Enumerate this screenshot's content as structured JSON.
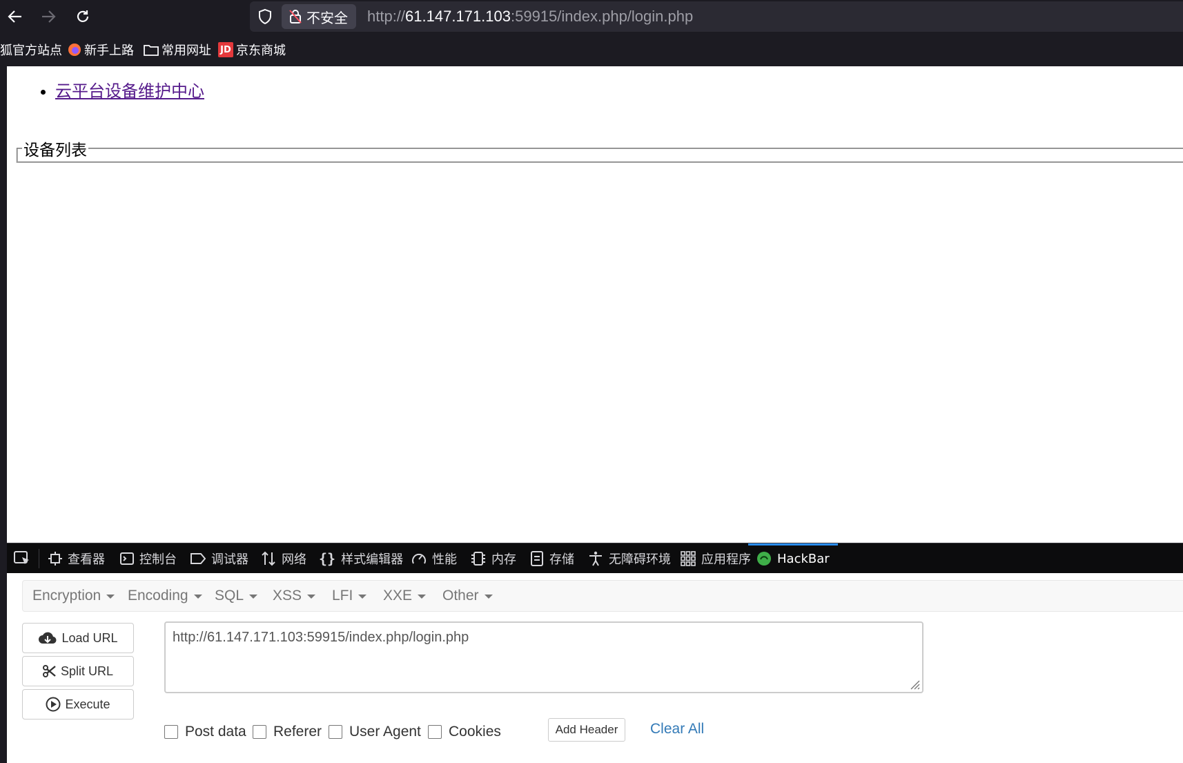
{
  "browser": {
    "security_label": "不安全",
    "url_scheme": "http://",
    "url_host": "61.147.171.103",
    "url_rest": ":59915/index.php/login.php"
  },
  "bookmarks": [
    {
      "label": "狐官方站点",
      "icon": "none"
    },
    {
      "label": "新手上路",
      "icon": "firefox-icon"
    },
    {
      "label": "常用网址",
      "icon": "folder-icon"
    },
    {
      "label": "京东商城",
      "icon": "jd-icon"
    }
  ],
  "jd_icon_text": "JD",
  "page": {
    "link_label": "云平台设备维护中心",
    "fieldset_legend": "设备列表"
  },
  "devtools": {
    "tabs": [
      {
        "label": "查看器",
        "icon": "inspector-icon"
      },
      {
        "label": "控制台",
        "icon": "console-icon"
      },
      {
        "label": "调试器",
        "icon": "debugger-icon"
      },
      {
        "label": "网络",
        "icon": "network-icon"
      },
      {
        "label": "样式编辑器",
        "icon": "style-editor-icon"
      },
      {
        "label": "性能",
        "icon": "performance-icon"
      },
      {
        "label": "内存",
        "icon": "memory-icon"
      },
      {
        "label": "存储",
        "icon": "storage-icon"
      },
      {
        "label": "无障碍环境",
        "icon": "accessibility-icon"
      },
      {
        "label": "应用程序",
        "icon": "application-icon"
      },
      {
        "label": "HackBar",
        "icon": "hackbar-icon"
      }
    ],
    "active_tab": "HackBar",
    "active_color": "#2a8df5"
  },
  "hackbar": {
    "menus": [
      "Encryption",
      "Encoding",
      "SQL",
      "XSS",
      "LFI",
      "XXE",
      "Other"
    ],
    "buttons": {
      "load_url": "Load URL",
      "split_url": "Split URL",
      "execute": "Execute"
    },
    "url_value": "http://61.147.171.103:59915/index.php/login.php",
    "checkboxes": [
      "Post data",
      "Referer",
      "User Agent",
      "Cookies"
    ],
    "add_header": "Add Header",
    "clear_all": "Clear All"
  }
}
